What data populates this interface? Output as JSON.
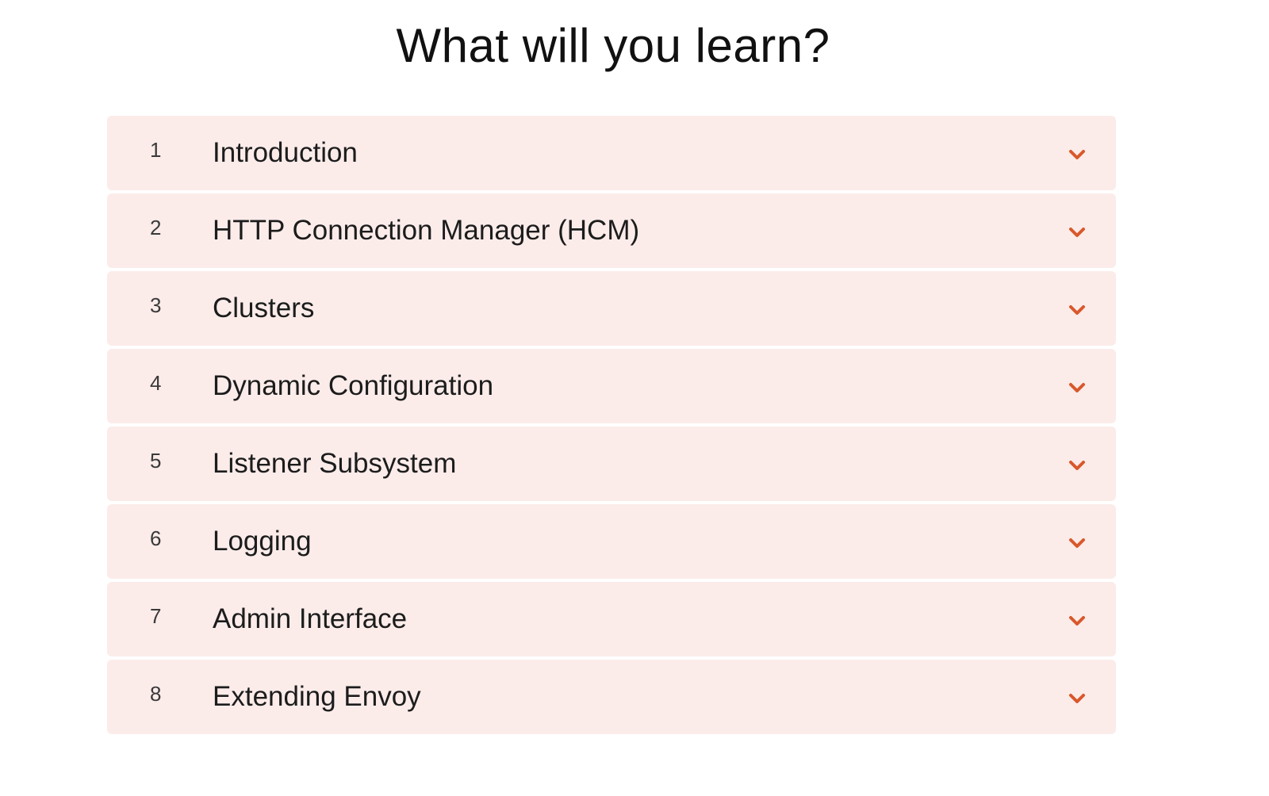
{
  "page": {
    "title": "What will you learn?"
  },
  "colors": {
    "row_background": "#fbecea",
    "chevron": "#d9582b"
  },
  "modules": [
    {
      "number": "1",
      "title": "Introduction",
      "icon": "chevron-down-icon"
    },
    {
      "number": "2",
      "title": "HTTP Connection Manager (HCM)",
      "icon": "chevron-down-icon"
    },
    {
      "number": "3",
      "title": "Clusters",
      "icon": "chevron-down-icon"
    },
    {
      "number": "4",
      "title": "Dynamic Configuration",
      "icon": "chevron-down-icon"
    },
    {
      "number": "5",
      "title": "Listener Subsystem",
      "icon": "chevron-down-icon"
    },
    {
      "number": "6",
      "title": "Logging",
      "icon": "chevron-down-icon"
    },
    {
      "number": "7",
      "title": "Admin Interface",
      "icon": "chevron-down-icon"
    },
    {
      "number": "8",
      "title": "Extending Envoy",
      "icon": "chevron-down-icon"
    }
  ]
}
